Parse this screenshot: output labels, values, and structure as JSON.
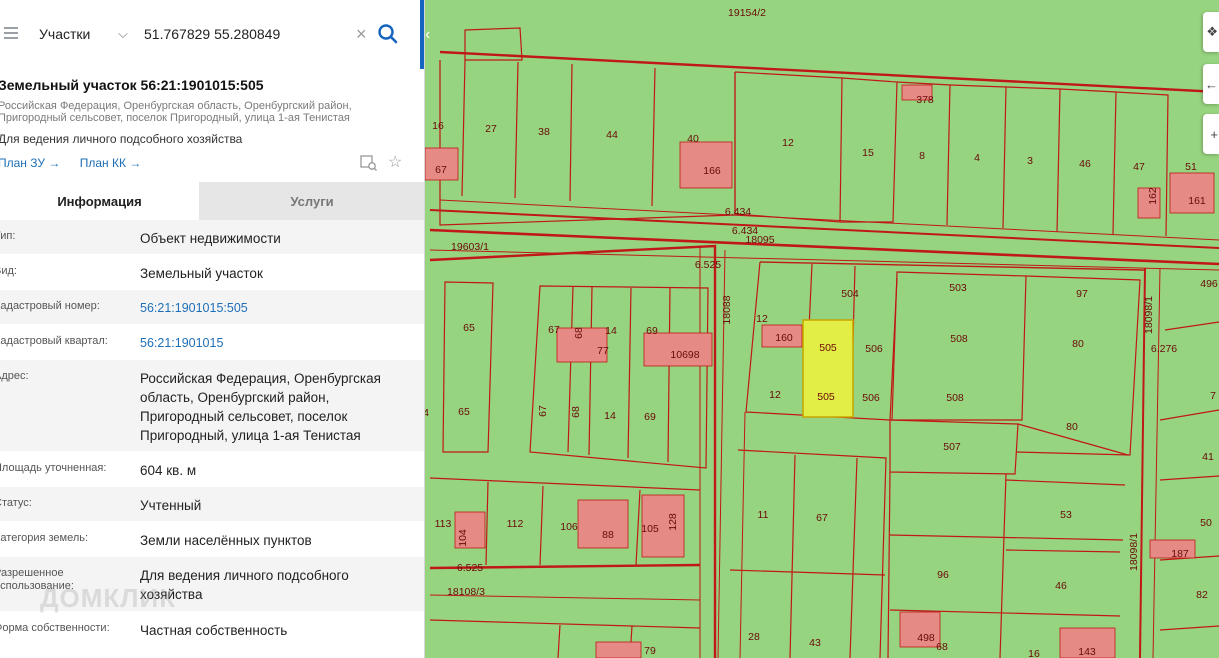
{
  "search": {
    "layer": "Участки",
    "query": "51.767829 55.280849"
  },
  "parcel": {
    "title": "Земельный участок 56:21:1901015:505",
    "address_line1": "Российская Федерация, Оренбургская область, Оренбургский район,",
    "address_line2": "Пригородный сельсовет, поселок Пригородный, улица 1-ая Тенистая",
    "purpose": "Для ведения личного подсобного хозяйства",
    "link_plan_zu": "План ЗУ →",
    "link_plan_kk": "План КК →"
  },
  "tabs": {
    "info": "Информация",
    "services": "Услуги"
  },
  "info_rows": {
    "r0": {
      "label": "Тип:",
      "value": "Объект недвижимости"
    },
    "r1": {
      "label": "Вид:",
      "value": "Земельный участок"
    },
    "r2": {
      "label": "Кадастровый номер:",
      "value": "56:21:1901015:505"
    },
    "r3": {
      "label": "Кадастровый квартал:",
      "value": "56:21:1901015"
    },
    "r4": {
      "label": "Адрес:",
      "value": "Российская Федерация, Оренбургская область, Оренбургский район, Пригородный сельсовет, поселок Пригородный, улица 1-ая Тенистая"
    },
    "r5": {
      "label": "Площадь уточненная:",
      "value": "604 кв. м"
    },
    "r6": {
      "label": "Статус:",
      "value": "Учтенный"
    },
    "r7": {
      "label": "Категория земель:",
      "value": "Земли населённых пунктов"
    },
    "r8": {
      "label": "Разрешенное использование:",
      "value": "Для ведения личного подсобного хозяйства"
    },
    "r9": {
      "label": "Форма собственности:",
      "value": "Частная собственность"
    }
  },
  "watermark": "ДОМКЛИК",
  "map_labels": {
    "t1": "19154/2",
    "t2": "16",
    "t3": "27",
    "t4": "38",
    "t5": "44",
    "t6": "40",
    "t7": "12",
    "t8": "15",
    "t9": "8",
    "t10": "4",
    "t11": "3",
    "t12": "46",
    "t13": "47",
    "t14": "51",
    "t15": "378",
    "t16": "67",
    "t17": "166",
    "t18": "162",
    "t19": "161",
    "t20": "6.434",
    "t21": "6.434",
    "t22": "18095",
    "t23": "19603/1",
    "t24": "6.525",
    "t25": "18088",
    "t26": "504",
    "t27": "503",
    "t28": "97",
    "t29": "18098/1",
    "t30": "496",
    "t31": "65",
    "t32": "67",
    "t33": "68",
    "t34": "14",
    "t35": "69",
    "t36": "77",
    "t37": "10698",
    "t38": "12",
    "t39": "160",
    "t40": "505",
    "t41": "506",
    "t42": "508",
    "t43": "80",
    "t44": "6.276",
    "t45": "65",
    "t46": "67",
    "t47": "68",
    "t48": "14",
    "t49": "69",
    "t50": "12",
    "t51": "505",
    "t52": "506",
    "t53": "508",
    "t54": "7",
    "t55": "507",
    "t56": "80",
    "t57": "41",
    "t58": "113",
    "t59": "104",
    "t60": "112",
    "t61": "106",
    "t62": "88",
    "t63": "105",
    "t64": "128",
    "t65": "11",
    "t66": "67",
    "t67": "53",
    "t68": "50",
    "t69": "6.525",
    "t70": "96",
    "t71": "18098/1",
    "t72": "187",
    "t73": "18108/3",
    "t74": "46",
    "t75": "82",
    "t76": "79",
    "t77": "28",
    "t78": "43",
    "t79": "498",
    "t80": "68",
    "t81": "16",
    "t82": "143",
    "t83": "4"
  },
  "colors": {
    "map_green": "#97d47f",
    "parcel_fill": "#e58a84",
    "boundary": "#c01818",
    "selected": "#e2ee45",
    "accent": "#1565c0"
  }
}
